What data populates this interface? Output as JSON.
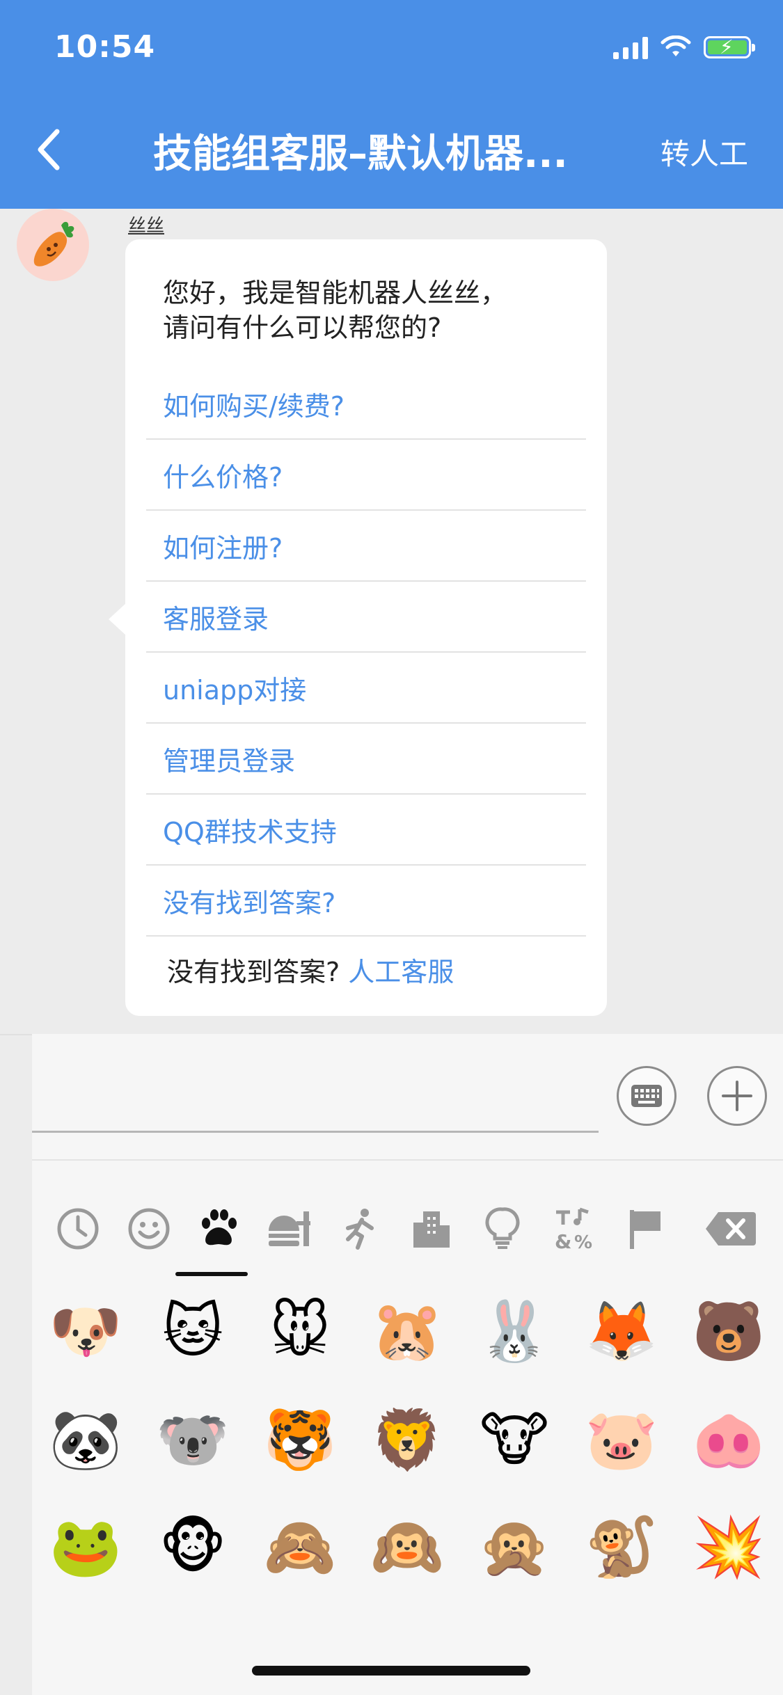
{
  "status_bar": {
    "time": "10:54"
  },
  "header": {
    "title": "技能组客服–默认机器...",
    "transfer_label": "转人工",
    "bg_color": "#4a8fe7"
  },
  "message": {
    "sender": "丝丝",
    "greeting_line1": "您好，我是智能机器人丝丝，",
    "greeting_line2": "请问有什么可以帮您的?",
    "faq_items": [
      "如何购买/续费?",
      "什么价格?",
      "如何注册?",
      "客服登录",
      "uniapp对接",
      "管理员登录",
      "QQ群技术支持",
      "没有找到答案?"
    ],
    "footer_text": "没有找到答案?",
    "footer_link": "人工客服"
  },
  "emoji_panel": {
    "categories": [
      "recent-icon",
      "smileys-icon",
      "animals-icon",
      "food-icon",
      "activity-icon",
      "travel-icon",
      "objects-icon",
      "symbols-icon",
      "flags-icon",
      "delete-icon"
    ],
    "selected_category": "animals-icon",
    "emojis": [
      [
        "🐶",
        "🐱",
        "🐭",
        "🐹",
        "🐰",
        "🦊",
        "🐻"
      ],
      [
        "🐼",
        "🐨",
        "🐯",
        "🦁",
        "🐮",
        "🐷",
        "🐽"
      ],
      [
        "🐸",
        "🐵",
        "🙈",
        "🙉",
        "🙊",
        "🐒",
        "💥"
      ]
    ]
  }
}
